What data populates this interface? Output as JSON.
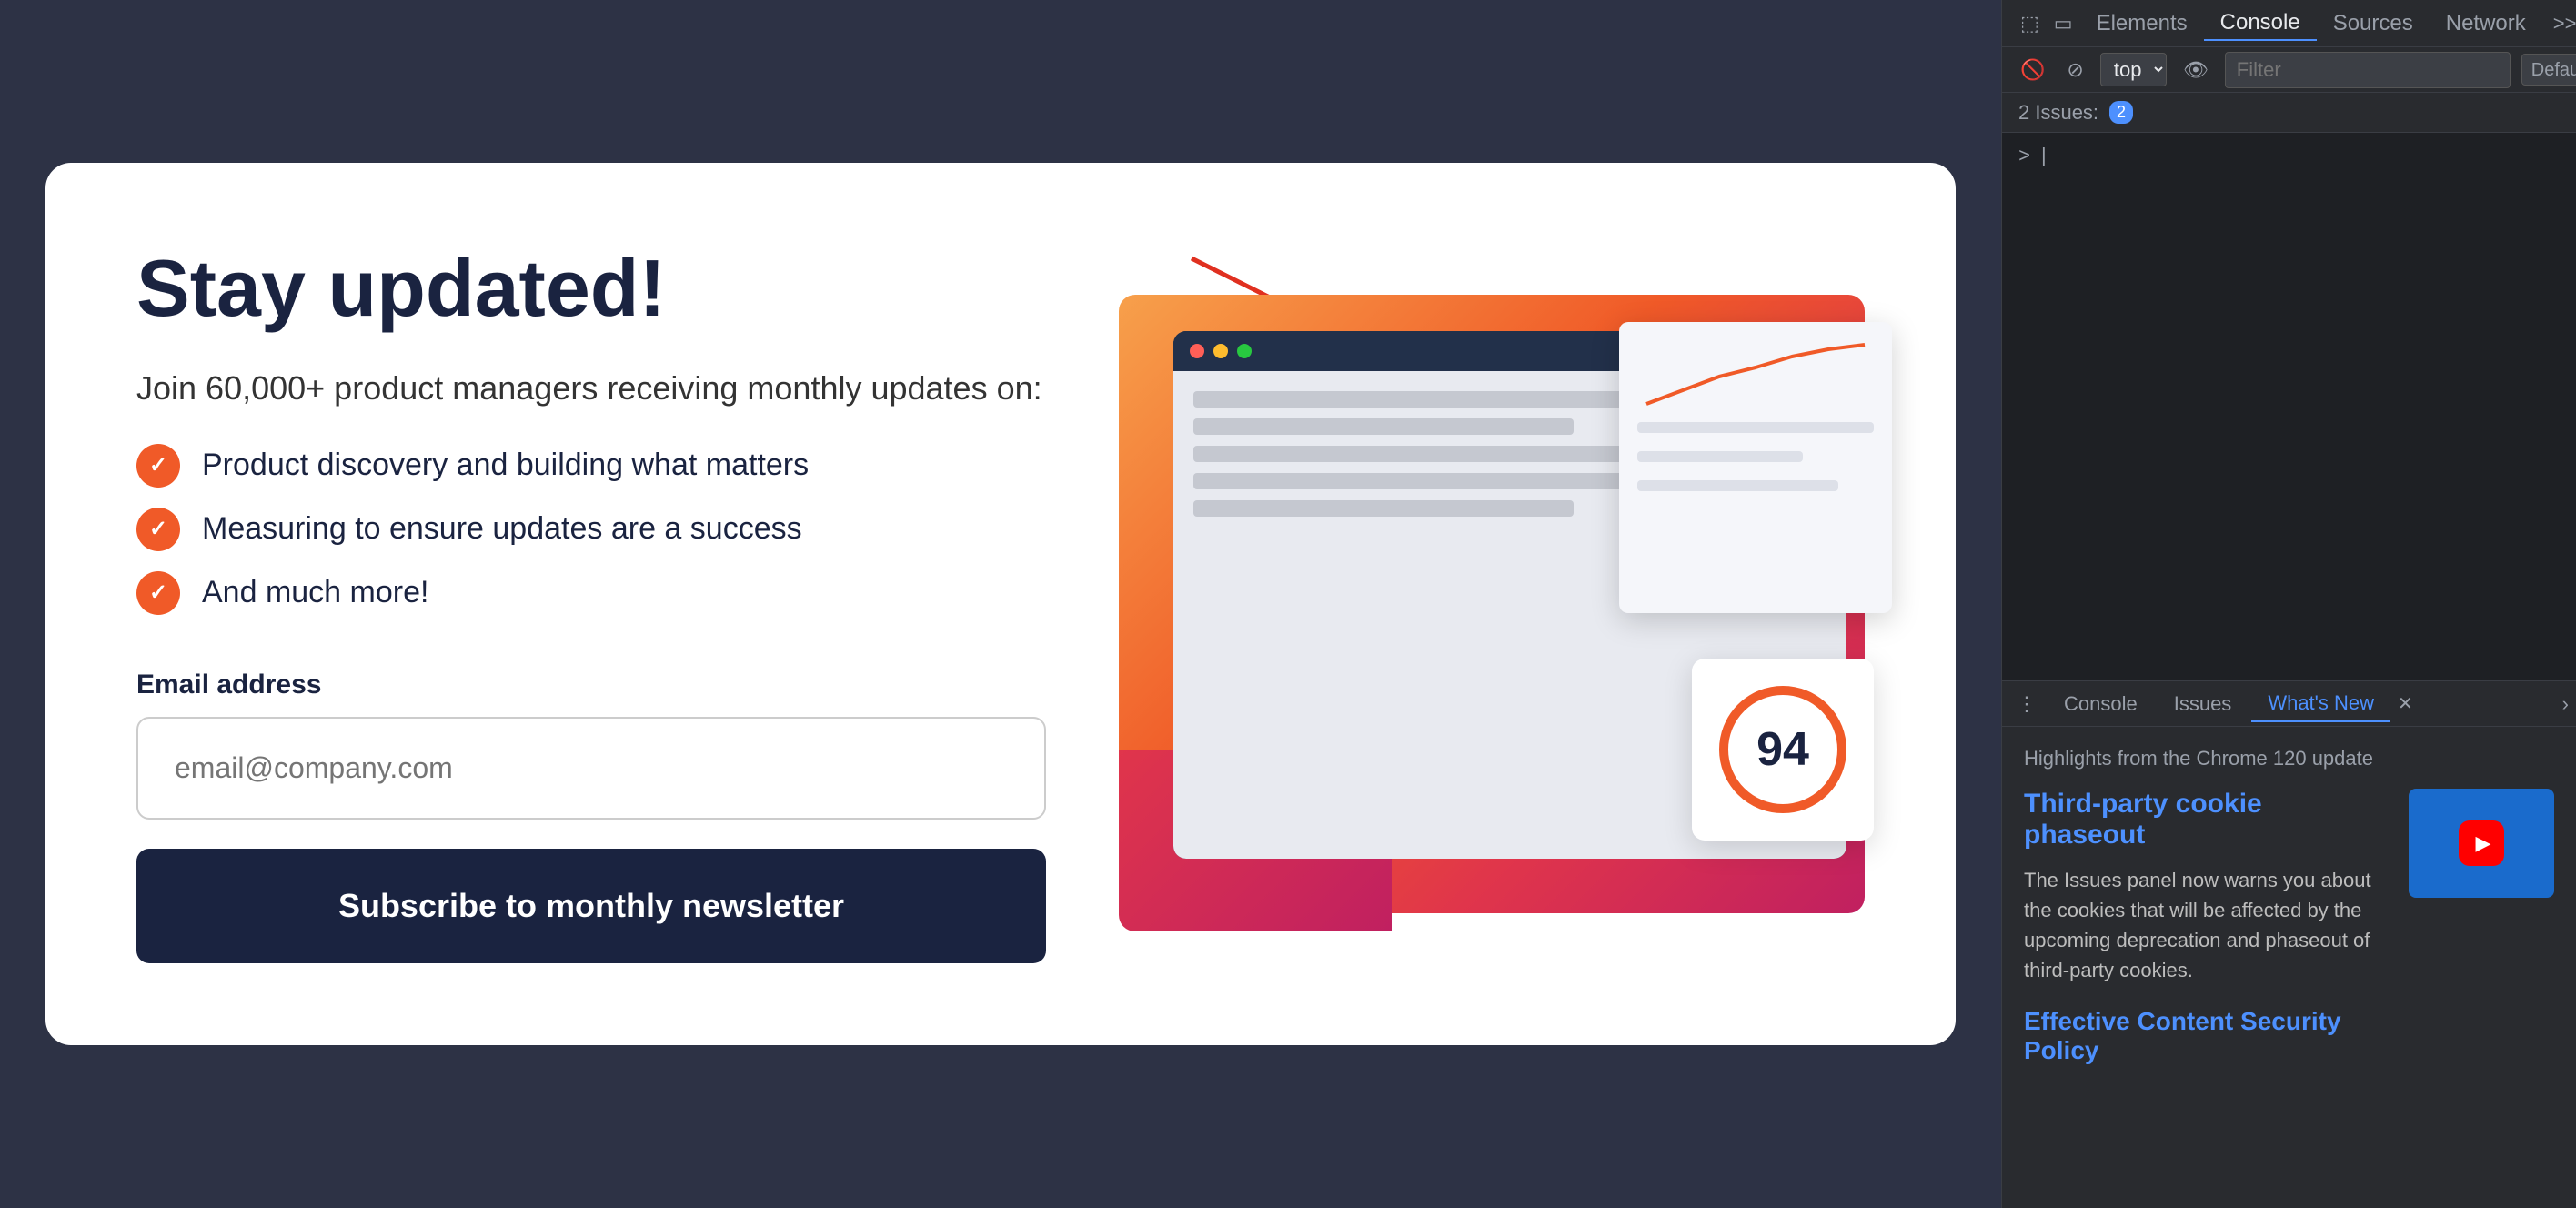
{
  "browser": {
    "card": {
      "headline": "Stay updated!",
      "subtext": "Join 60,000+ product managers receiving monthly updates on:",
      "checklist": [
        "Product discovery and building what matters",
        "Measuring to ensure updates are a success",
        "And much more!"
      ],
      "email_label": "Email address",
      "email_placeholder": "email@company.com",
      "subscribe_label": "Subscribe to monthly newsletter",
      "score": "94"
    }
  },
  "devtools": {
    "topbar": {
      "tabs": [
        "Elements",
        "Console",
        "Sources",
        "Network"
      ],
      "more_icon": "⋮⋮",
      "badge_count": "2",
      "settings_icon": "⚙"
    },
    "toolbar": {
      "top_label": "top",
      "filter_placeholder": "Filter",
      "default_levels": "Default levels ▾",
      "settings": "⚙"
    },
    "issues": {
      "label": "2 Issues:",
      "count": "2"
    },
    "console_prompt": ">",
    "bottom_tabs": {
      "tabs": [
        "Console",
        "Issues",
        "What's New"
      ],
      "active": "What's New"
    },
    "whats_new": {
      "highlights": "Highlights from the Chrome 120 update",
      "third_party_title": "Third-party cookie phaseout",
      "third_party_desc": "The Issues panel now warns you about the cookies that will be affected by the upcoming deprecation and phaseout of third-party cookies.",
      "effective_csp": "Effective Content Security Policy"
    }
  }
}
